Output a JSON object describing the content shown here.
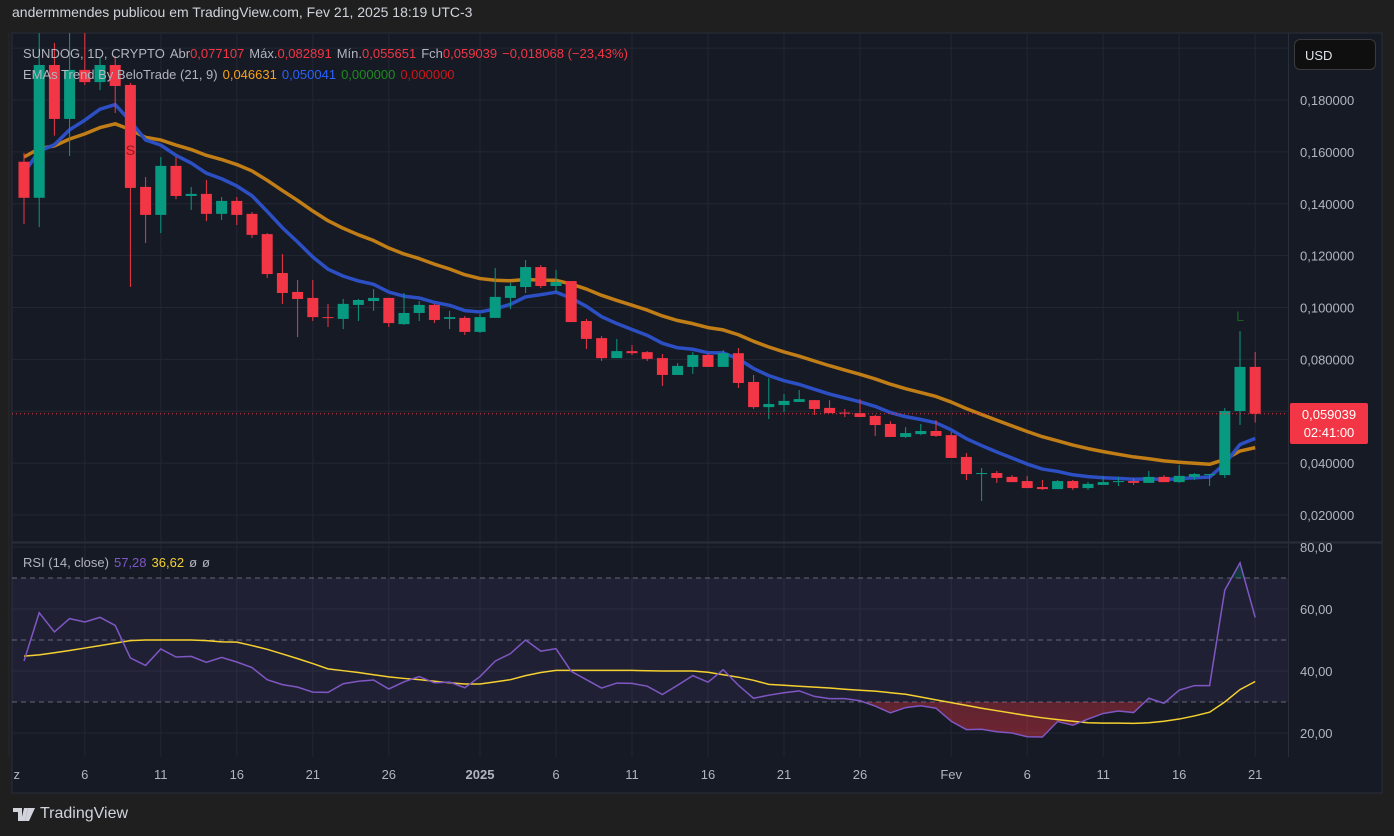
{
  "header": {
    "published": "andermmendes publicou em TradingView.com, Fev 21, 2025 18:19 UTC-3"
  },
  "legend": {
    "symbol": "SUNDOG, 1D, CRYPTO",
    "open_label": "Abr",
    "open": "0,077107",
    "high_label": "Máx.",
    "high": "0,082891",
    "low_label": "Mín.",
    "low": "0,055651",
    "close_label": "Fch",
    "close": "0,059039",
    "change": "−0,018068 (−23,43%)",
    "indicator": "EMAs Trend By BeloTrade (21, 9)",
    "ema21": "0,046631",
    "ema9": "0,050041",
    "v3": "0,000000",
    "v4": "0,000000",
    "rsi_title": "RSI (14, close)",
    "rsi_value": "57,28",
    "rsi_ma_value": "36,62",
    "rsi_na1": "ø",
    "rsi_na2": "ø"
  },
  "currency_button": "USD",
  "last_price": {
    "value": "0,059039",
    "countdown": "02:41:00"
  },
  "branding": {
    "name": "TradingView"
  },
  "colors": {
    "up": "#089981",
    "down": "#f23645",
    "ema21": "#c17d16",
    "ema9": "#2c4fc4",
    "rsi": "#7e57c2",
    "rsi_ma": "#f5d130",
    "background": "#161a25"
  },
  "chart_data": {
    "type": "candlestick",
    "price_axis": {
      "ticks": [
        "0,020000",
        "0,040000",
        "0,060000",
        "0,080000",
        "0,100000",
        "0,120000",
        "0,140000",
        "0,160000",
        "0,180000"
      ],
      "tick_values": [
        0.02,
        0.04,
        0.06,
        0.08,
        0.1,
        0.12,
        0.14,
        0.16,
        0.18
      ]
    },
    "time_axis": {
      "ticks": [
        {
          "label": "z",
          "date": "2024-12-01"
        },
        {
          "label": "6",
          "date": "2024-12-06"
        },
        {
          "label": "11",
          "date": "2024-12-11"
        },
        {
          "label": "16",
          "date": "2024-12-16"
        },
        {
          "label": "21",
          "date": "2024-12-21"
        },
        {
          "label": "26",
          "date": "2024-12-26"
        },
        {
          "label": "2025",
          "date": "2025-01-01",
          "bold": true
        },
        {
          "label": "6",
          "date": "2025-01-06"
        },
        {
          "label": "11",
          "date": "2025-01-11"
        },
        {
          "label": "16",
          "date": "2025-01-16"
        },
        {
          "label": "21",
          "date": "2025-01-21"
        },
        {
          "label": "26",
          "date": "2025-01-26"
        },
        {
          "label": "Fev",
          "date": "2025-02-01"
        },
        {
          "label": "6",
          "date": "2025-02-06"
        },
        {
          "label": "11",
          "date": "2025-02-11"
        },
        {
          "label": "16",
          "date": "2025-02-16"
        },
        {
          "label": "21",
          "date": "2025-02-21"
        }
      ]
    },
    "rsi_axis": {
      "ticks": [
        "20,00",
        "40,00",
        "60,00",
        "80,00"
      ],
      "tick_values": [
        20,
        40,
        60,
        80
      ],
      "bands": [
        30,
        50,
        70
      ]
    },
    "first_date": "2024-12-02",
    "ohlc": [
      [
        0.1562,
        0.1596,
        0.1322,
        0.1423
      ],
      [
        0.1423,
        0.2058,
        0.131,
        0.1935
      ],
      [
        0.1935,
        0.202,
        0.1663,
        0.1727
      ],
      [
        0.1727,
        0.2058,
        0.1584,
        0.1916
      ],
      [
        0.1916,
        0.21,
        0.1858,
        0.1869
      ],
      [
        0.1869,
        0.1962,
        0.1838,
        0.1935
      ],
      [
        0.1935,
        0.197,
        0.175,
        0.1854
      ],
      [
        0.1858,
        0.1866,
        0.1079,
        0.1461
      ],
      [
        0.1465,
        0.1503,
        0.1249,
        0.1357
      ],
      [
        0.1357,
        0.158,
        0.1287,
        0.1546
      ],
      [
        0.1546,
        0.158,
        0.1418,
        0.143
      ],
      [
        0.143,
        0.1465,
        0.1376,
        0.1438
      ],
      [
        0.1438,
        0.1492,
        0.1333,
        0.1361
      ],
      [
        0.1361,
        0.1426,
        0.1337,
        0.1411
      ],
      [
        0.1411,
        0.1426,
        0.1318,
        0.1357
      ],
      [
        0.1361,
        0.1368,
        0.1268,
        0.128
      ],
      [
        0.1283,
        0.1287,
        0.1114,
        0.1129
      ],
      [
        0.1133,
        0.1206,
        0.1014,
        0.1056
      ],
      [
        0.106,
        0.1106,
        0.0886,
        0.1033
      ],
      [
        0.1037,
        0.1106,
        0.0948,
        0.0963
      ],
      [
        0.0963,
        0.1014,
        0.0925,
        0.096
      ],
      [
        0.0956,
        0.1033,
        0.0917,
        0.1014
      ],
      [
        0.101,
        0.1033,
        0.0948,
        0.1029
      ],
      [
        0.1025,
        0.1071,
        0.0987,
        0.1037
      ],
      [
        0.1037,
        0.1037,
        0.0925,
        0.094
      ],
      [
        0.0936,
        0.1056,
        0.0933,
        0.0979
      ],
      [
        0.0979,
        0.1025,
        0.0948,
        0.101
      ],
      [
        0.101,
        0.1014,
        0.094,
        0.0952
      ],
      [
        0.0956,
        0.0987,
        0.0917,
        0.0963
      ],
      [
        0.096,
        0.0967,
        0.0894,
        0.0906
      ],
      [
        0.0906,
        0.0975,
        0.0902,
        0.0963
      ],
      [
        0.096,
        0.1152,
        0.096,
        0.1041
      ],
      [
        0.1037,
        0.1095,
        0.0994,
        0.1083
      ],
      [
        0.1079,
        0.1183,
        0.1056,
        0.1156
      ],
      [
        0.1156,
        0.1164,
        0.1075,
        0.1083
      ],
      [
        0.1083,
        0.1145,
        0.106,
        0.1098
      ],
      [
        0.1102,
        0.1102,
        0.0944,
        0.0944
      ],
      [
        0.0948,
        0.0956,
        0.084,
        0.0879
      ],
      [
        0.0882,
        0.089,
        0.0794,
        0.0805
      ],
      [
        0.0805,
        0.0879,
        0.0805,
        0.0832
      ],
      [
        0.0832,
        0.0855,
        0.0817,
        0.0824
      ],
      [
        0.0828,
        0.0832,
        0.0794,
        0.0802
      ],
      [
        0.0805,
        0.0821,
        0.0698,
        0.074
      ],
      [
        0.074,
        0.0786,
        0.074,
        0.0775
      ],
      [
        0.0771,
        0.0828,
        0.0744,
        0.0817
      ],
      [
        0.0817,
        0.0824,
        0.0771,
        0.0771
      ],
      [
        0.0771,
        0.0836,
        0.0771,
        0.0824
      ],
      [
        0.0824,
        0.0844,
        0.069,
        0.0709
      ],
      [
        0.0713,
        0.074,
        0.0609,
        0.0616
      ],
      [
        0.0616,
        0.0728,
        0.057,
        0.0628
      ],
      [
        0.0624,
        0.0667,
        0.0597,
        0.064
      ],
      [
        0.0636,
        0.0682,
        0.0636,
        0.0647
      ],
      [
        0.0643,
        0.0643,
        0.0586,
        0.0609
      ],
      [
        0.0613,
        0.0643,
        0.0593,
        0.0593
      ],
      [
        0.0595,
        0.0609,
        0.0578,
        0.0591
      ],
      [
        0.0593,
        0.0647,
        0.0578,
        0.0578
      ],
      [
        0.0582,
        0.0586,
        0.0505,
        0.0547
      ],
      [
        0.0551,
        0.0562,
        0.0501,
        0.0501
      ],
      [
        0.0501,
        0.0539,
        0.0497,
        0.0516
      ],
      [
        0.0512,
        0.0551,
        0.0508,
        0.0524
      ],
      [
        0.0524,
        0.0566,
        0.0501,
        0.0505
      ],
      [
        0.0508,
        0.052,
        0.042,
        0.042
      ],
      [
        0.0424,
        0.0439,
        0.0335,
        0.0358
      ],
      [
        0.0358,
        0.0381,
        0.0254,
        0.0362
      ],
      [
        0.0362,
        0.037,
        0.0324,
        0.0343
      ],
      [
        0.0347,
        0.0354,
        0.0327,
        0.0327
      ],
      [
        0.0331,
        0.0351,
        0.0304,
        0.0304
      ],
      [
        0.0308,
        0.0335,
        0.0297,
        0.03
      ],
      [
        0.03,
        0.0335,
        0.03,
        0.0331
      ],
      [
        0.0331,
        0.0335,
        0.0297,
        0.0304
      ],
      [
        0.0304,
        0.0327,
        0.0297,
        0.032
      ],
      [
        0.0316,
        0.0351,
        0.0316,
        0.0327
      ],
      [
        0.0327,
        0.0347,
        0.0312,
        0.0331
      ],
      [
        0.0331,
        0.0343,
        0.0316,
        0.0324
      ],
      [
        0.0324,
        0.037,
        0.0324,
        0.0347
      ],
      [
        0.0347,
        0.0354,
        0.0327,
        0.0327
      ],
      [
        0.0327,
        0.0393,
        0.0324,
        0.0351
      ],
      [
        0.0347,
        0.0362,
        0.0335,
        0.0358
      ],
      [
        0.0354,
        0.0358,
        0.0312,
        0.0358
      ],
      [
        0.0354,
        0.0613,
        0.0343,
        0.0601
      ],
      [
        0.0601,
        0.0909,
        0.0547,
        0.0771
      ],
      [
        0.077107,
        0.082891,
        0.055651,
        0.059039
      ]
    ],
    "ema_periods": [
      21,
      9
    ],
    "rsi": [
      43.2,
      58.8,
      52.6,
      56.9,
      55.8,
      57.3,
      54.7,
      44.2,
      41.8,
      47.1,
      44.5,
      44.7,
      42.8,
      44.4,
      42.9,
      41.1,
      37.2,
      35.6,
      34.8,
      33.2,
      33.1,
      35.9,
      36.7,
      37.1,
      34.2,
      36.5,
      38.2,
      36.2,
      36.4,
      34.6,
      38.2,
      43.2,
      45.6,
      50.0,
      46.4,
      47.2,
      39.9,
      37.2,
      34.5,
      36.1,
      36.0,
      35.1,
      32.4,
      35.4,
      38.5,
      36.4,
      40.4,
      35.4,
      31.2,
      32.2,
      33.0,
      33.6,
      31.8,
      31.1,
      31.1,
      30.4,
      28.7,
      26.5,
      28.2,
      28.8,
      28.0,
      23.8,
      21.1,
      21.2,
      20.4,
      20.0,
      18.8,
      18.7,
      23.7,
      22.5,
      24.5,
      26.3,
      27.1,
      26.6,
      31.2,
      29.6,
      33.8,
      35.3,
      35.3,
      66.1,
      74.9,
      57.28
    ],
    "rsi_ma": [
      44.8,
      45.2,
      45.9,
      46.6,
      47.4,
      48.2,
      49.0,
      49.8,
      50.0,
      50.0,
      50.0,
      50.0,
      49.8,
      49.4,
      49.3,
      48.2,
      47.0,
      45.5,
      44.0,
      42.4,
      40.7,
      40.1,
      39.5,
      38.8,
      38.1,
      37.6,
      37.2,
      36.7,
      36.2,
      35.8,
      35.8,
      36.5,
      37.2,
      38.5,
      39.5,
      40.2,
      40.2,
      40.2,
      40.2,
      40.2,
      40.2,
      40.1,
      40.0,
      40.0,
      40.0,
      39.6,
      38.8,
      38.0,
      37.0,
      35.7,
      35.4,
      35.1,
      34.8,
      34.5,
      34.1,
      33.8,
      33.5,
      33.0,
      32.5,
      31.6,
      30.7,
      29.8,
      28.9,
      28.0,
      27.2,
      26.4,
      25.6,
      24.9,
      24.3,
      23.8,
      23.3,
      23.2,
      23.2,
      23.1,
      23.3,
      23.8,
      24.5,
      25.5,
      26.7,
      30.0,
      34.0,
      36.62
    ],
    "signals": [
      {
        "label": "S",
        "date": "2024-12-09",
        "type": "sell",
        "color": "#8e1b1b"
      },
      {
        "label": "L",
        "date": "2025-02-20",
        "type": "long",
        "color": "#1b5e20"
      }
    ],
    "last_price_line": 0.059039
  }
}
